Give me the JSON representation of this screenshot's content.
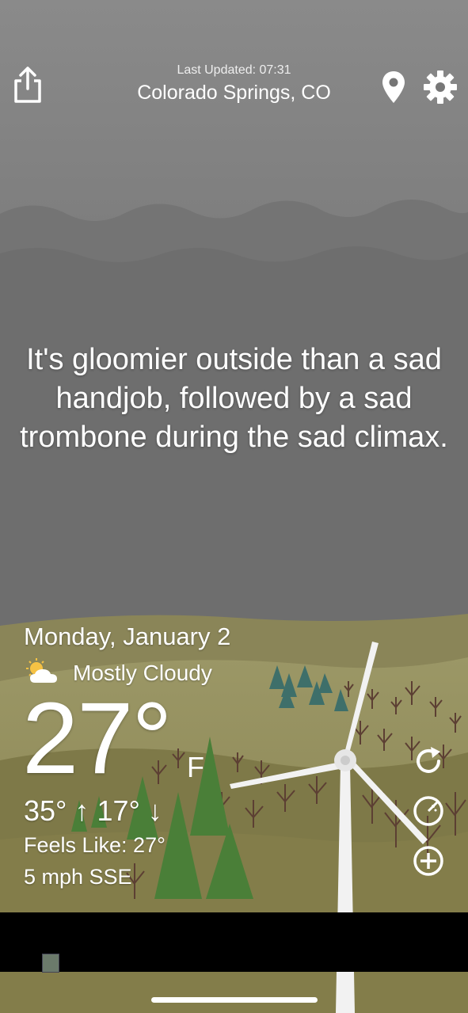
{
  "header": {
    "last_updated": "Last Updated: 07:31",
    "location": "Colorado Springs, CO",
    "icons": {
      "share": "share-icon",
      "location": "location-pin-icon",
      "settings": "gear-icon"
    }
  },
  "quote": "It's gloomier outside than a sad handjob, followed by a sad trombone during the sad climax.",
  "weather": {
    "date": "Monday, January 2",
    "condition": "Mostly Cloudy",
    "condition_icon": "partly-cloudy-icon",
    "temperature": "27°",
    "unit": "F",
    "high_low": "35° ↑ 17° ↓",
    "feels_like": "Feels Like: 27°",
    "wind": "5 mph SSE"
  },
  "side_actions": [
    {
      "name": "refresh-button",
      "icon": "refresh-icon"
    },
    {
      "name": "radar-button",
      "icon": "radar-icon"
    },
    {
      "name": "add-location-button",
      "icon": "plus-circle-icon"
    }
  ],
  "colors": {
    "sky": "#757575",
    "ground": "#8d8a57",
    "tree_green": "#4a7f38",
    "ad_bar": "#000000"
  }
}
